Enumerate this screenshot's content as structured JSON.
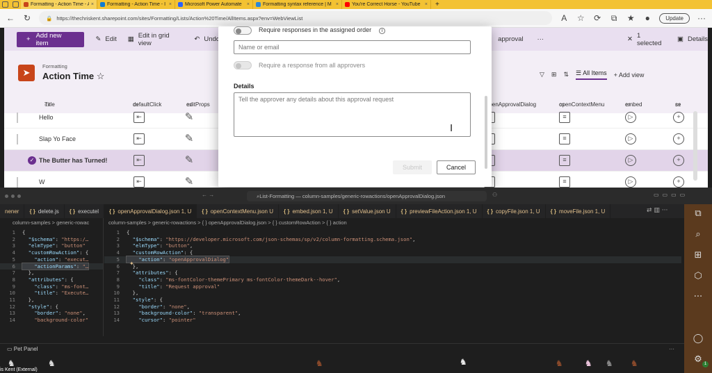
{
  "browser": {
    "tabs": [
      {
        "label": "Formatting - Action Time - All I",
        "color": "#c8451a",
        "active": true
      },
      {
        "label": "Formatting - Action Time - I",
        "color": "#0f7bd1",
        "active": false
      },
      {
        "label": "Microsoft Power Automate",
        "color": "#2962ff",
        "active": false
      },
      {
        "label": "Formatting syntax reference | M",
        "color": "#2b88d8",
        "active": false
      },
      {
        "label": "You're Correct Horse - YouTube",
        "color": "#ff0000",
        "active": false
      }
    ],
    "new_tab": "+",
    "url": "https://thechriskent.sharepoint.com/sites/Formatting/Lists/Action%20Time/AllItems.aspx?env=WebViewList",
    "update_label": "Update"
  },
  "sharepoint": {
    "command_bar": {
      "new_item": "Add new item",
      "edit": "Edit",
      "edit_grid": "Edit in grid view",
      "undo": "Undo",
      "approval": "approval",
      "more": "···",
      "selected": "1 selected",
      "details": "Details"
    },
    "site": {
      "subtitle": "Formatting",
      "title": "Action Time",
      "favorite_icon": "☆"
    },
    "view_tools": {
      "all_items": "All Items",
      "add_view": "+ Add view"
    },
    "columns": [
      {
        "label": "Title"
      },
      {
        "label": "defaultClick"
      },
      {
        "label": "editProps"
      },
      {
        "label": "openApprovalDialog"
      },
      {
        "label": "openContextMenu"
      },
      {
        "label": "embed"
      },
      {
        "label": "se"
      }
    ],
    "rows": [
      {
        "title": "Hello",
        "selected": false
      },
      {
        "title": "Slap Yo Face",
        "selected": false
      },
      {
        "title": "The Butter has Turned!",
        "selected": true
      },
      {
        "title": "W",
        "selected": false
      }
    ]
  },
  "dialog": {
    "toggle1_label": "Require responses in the assigned order",
    "name_placeholder": "Name or email",
    "toggle2_label": "Require a response from all approvers",
    "details_label": "Details",
    "details_placeholder": "Tell the approver any details about this approval request",
    "submit": "Submit",
    "cancel": "Cancel"
  },
  "vscode": {
    "command_center": "List-Formatting — column-samples/generic-rowactions/openApprovalDialog.json",
    "tabs": [
      {
        "label": "nener",
        "badge": "",
        "tone": "yellow"
      },
      {
        "label": "delete.js",
        "badge": "{ }",
        "tone": "white"
      },
      {
        "label": "executel",
        "badge": "{ }",
        "tone": "white"
      },
      {
        "label": "openApprovalDialog.json 1, U",
        "badge": "{ }",
        "tone": "yellow"
      },
      {
        "label": "openContextMenu.json U",
        "badge": "{ }",
        "tone": "yellow"
      },
      {
        "label": "embed.json 1, U",
        "badge": "{ }",
        "tone": "yellow"
      },
      {
        "label": "setValue.json U",
        "badge": "{ }",
        "tone": "yellow"
      },
      {
        "label": "previewFileAction.json 1, U",
        "badge": "{ }",
        "tone": "yellow"
      },
      {
        "label": "copyFile.json 1, U",
        "badge": "{ }",
        "tone": "yellow"
      },
      {
        "label": "moveFile.json 1, U",
        "badge": "{ }",
        "tone": "yellow"
      }
    ],
    "left_crumbs": "column-samples > generic-rowac",
    "right_crumbs": "column-samples > generic-rowactions > { } openApprovalDialog.json > { } customRowAction > { } action",
    "left_code": [
      "{",
      "  \"$schema\": \"https:/…",
      "  \"elmType\": \"button\"",
      "  \"customRowAction\": {",
      "    \"action\": \"execut…",
      "    \"actionParams\": \"…",
      "  },",
      "  \"attributes\": {",
      "    \"class\": \"ms-font…",
      "    \"title\": \"Execute…",
      "  },",
      "  \"style\": {",
      "    \"border\": \"none\",",
      "    \"background-color\""
    ],
    "right_code": [
      "{",
      "  \"$schema\": \"https://developer.microsoft.com/json-schemas/sp/v2/column-formatting.schema.json\",",
      "  \"elmType\": \"button\",",
      "  \"customRowAction\": {",
      "    \"action\": \"openApprovalDialog\"",
      "  },",
      "  \"attributes\": {",
      "    \"class\": \"ms-fontColor-themePrimary ms-fontColor-themeDark--hover\",",
      "    \"title\": \"Request approval\"",
      "  },",
      "  \"style\": {",
      "    \"border\": \"none\",",
      "    \"background-color\": \"transparent\",",
      "    \"cursor\": \"pointer\""
    ],
    "pet_panel_title": "Pet Panel",
    "user_name": "is Kent (External)",
    "activity_badge": "1"
  }
}
